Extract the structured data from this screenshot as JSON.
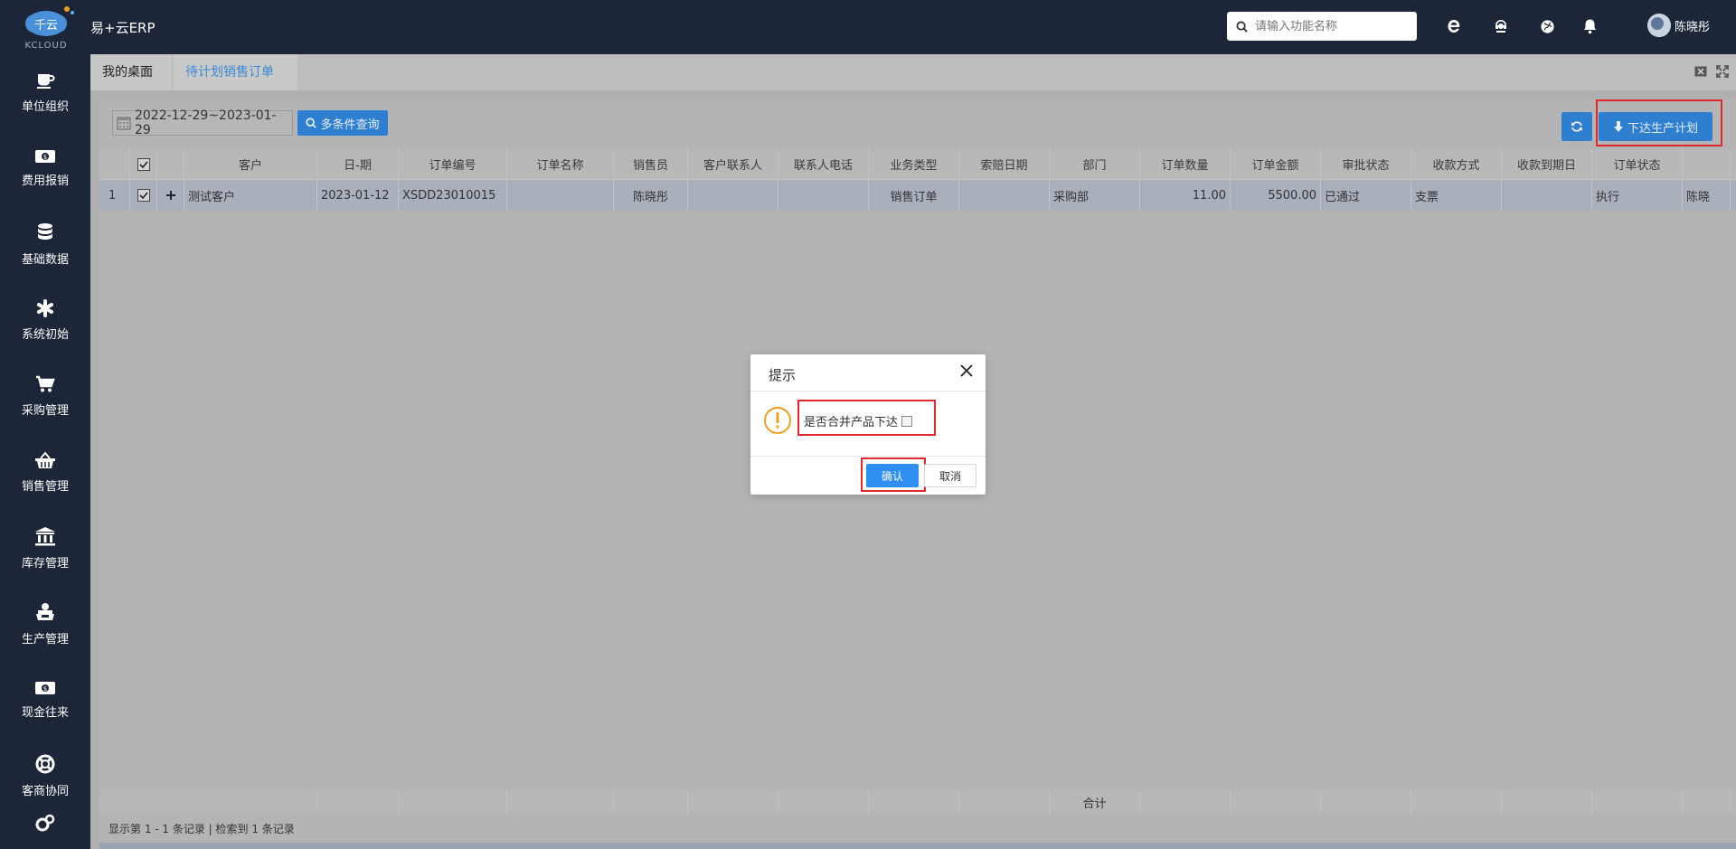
{
  "app": {
    "title": "易+云ERP",
    "logo_text": "千云",
    "logo_sub": "KCLOUD"
  },
  "search": {
    "placeholder": "请输入功能名称"
  },
  "user": {
    "name": "陈晓彤"
  },
  "topbar_icons": [
    "ie-icon",
    "headset-icon",
    "globe-icon",
    "bell-icon"
  ],
  "sidebar": {
    "items": [
      {
        "label": "单位组织",
        "icon": "coffee-icon"
      },
      {
        "label": "费用报销",
        "icon": "money-icon"
      },
      {
        "label": "基础数据",
        "icon": "database-icon"
      },
      {
        "label": "系统初始",
        "icon": "asterisk-icon"
      },
      {
        "label": "采购管理",
        "icon": "cart-icon"
      },
      {
        "label": "销售管理",
        "icon": "basket-icon"
      },
      {
        "label": "库存管理",
        "icon": "bank-icon"
      },
      {
        "label": "生产管理",
        "icon": "factory-icon"
      },
      {
        "label": "现金往来",
        "icon": "money-icon"
      },
      {
        "label": "客商协同",
        "icon": "lifebuoy-icon"
      }
    ]
  },
  "tabs": [
    {
      "label": "我的桌面"
    },
    {
      "label": "待计划销售订单"
    }
  ],
  "toolbar": {
    "date_range": "2022-12-29~2023-01-29",
    "query_label": "多条件查询",
    "issue_label": "下达生产计划"
  },
  "grid": {
    "columns": [
      "客户",
      "日-期",
      "订单编号",
      "订单名称",
      "销售员",
      "客户联系人",
      "联系人电话",
      "业务类型",
      "索赔日期",
      "部门",
      "订单数量",
      "订单金额",
      "审批状态",
      "收款方式",
      "收款到期日",
      "订单状态"
    ],
    "rows": [
      {
        "index": "1",
        "cells": [
          "测试客户",
          "2023-01-12",
          "XSDD23010015",
          "",
          "陈晓彤",
          "",
          "",
          "销售订单",
          "",
          "采购部",
          "11.00",
          "5500.00",
          "已通过",
          "支票",
          "",
          "执行",
          "陈晓"
        ]
      }
    ],
    "footer_label": "合计",
    "status_text": "显示第 1 - 1 条记录 | 检索到 1 条记录"
  },
  "dialog": {
    "title": "提示",
    "message": "是否合并产品下达",
    "ok_label": "确认",
    "cancel_label": "取消"
  },
  "colors": {
    "primary": "#2f7fd0",
    "dialog_ok": "#2e8ef2",
    "highlight": "#e0282e",
    "warning": "#f0a020",
    "nav_bg": "#1c2638"
  }
}
